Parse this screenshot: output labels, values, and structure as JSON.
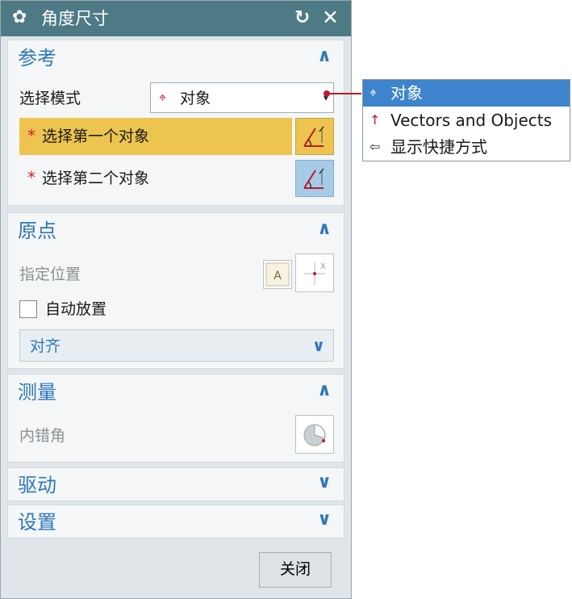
{
  "titlebar": {
    "title": "角度尺寸",
    "gear_glyph": "✿",
    "reset_glyph": "↻",
    "close_glyph": "✕"
  },
  "groups": {
    "reference": {
      "title": "参考",
      "select_mode_label": "选择模式",
      "select_mode_value": "对象",
      "first_object": "选择第一个对象",
      "second_object": "选择第二个对象"
    },
    "origin": {
      "title": "原点",
      "specify_location": "指定位置",
      "auto_place": "自动放置",
      "align": "对齐"
    },
    "measure": {
      "title": "测量",
      "inner_angle": "内错角"
    },
    "drive": {
      "title": "驱动"
    },
    "settings": {
      "title": "设置"
    }
  },
  "footer": {
    "close_label": "关闭"
  },
  "popup": {
    "items": [
      {
        "label": "对象",
        "icon": "crosshair-icon",
        "selected": true
      },
      {
        "label": "Vectors and Objects",
        "icon": "vector-arrow-icon",
        "selected": false
      },
      {
        "label": "显示快捷方式",
        "icon": "shortcut-arrow-icon",
        "selected": false
      }
    ]
  },
  "glyphs": {
    "required": "*",
    "expanded": "∧",
    "collapsed": "∨",
    "combo_arrow": "▾"
  },
  "colors": {
    "titlebar": "#4d7a85",
    "accent": "#2e78b8",
    "active_row": "#ecc44f",
    "required": "#d0232e",
    "popup_selected": "#3d84cc"
  }
}
